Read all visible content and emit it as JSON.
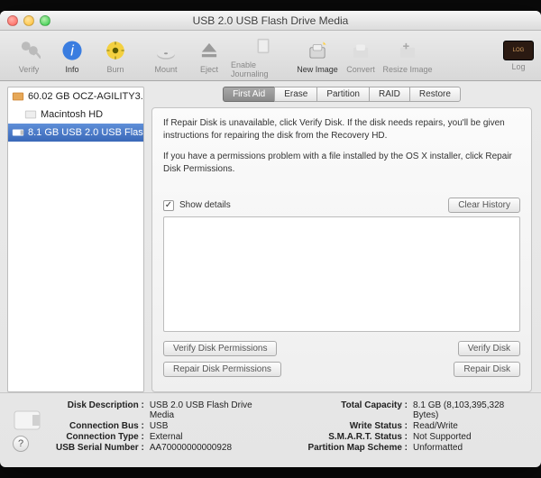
{
  "window": {
    "title": "USB 2.0 USB Flash Drive Media"
  },
  "toolbar": {
    "verify": "Verify",
    "info": "Info",
    "burn": "Burn",
    "mount": "Mount",
    "eject": "Eject",
    "enable_journaling": "Enable Journaling",
    "new_image": "New Image",
    "convert": "Convert",
    "resize_image": "Resize Image",
    "log": "Log"
  },
  "sidebar": {
    "items": [
      {
        "label": "60.02 GB OCZ-AGILITY3..."
      },
      {
        "label": "Macintosh HD"
      },
      {
        "label": "8.1 GB USB 2.0 USB Flas..."
      }
    ]
  },
  "tabs": {
    "first_aid": "First Aid",
    "erase": "Erase",
    "partition": "Partition",
    "raid": "RAID",
    "restore": "Restore"
  },
  "panel": {
    "desc1": "If Repair Disk is unavailable, click Verify Disk. If the disk needs repairs, you'll be given instructions for repairing the disk from the Recovery HD.",
    "desc2": "If you have a permissions problem with a file installed by the OS X installer, click Repair Disk Permissions.",
    "show_details": "Show details",
    "clear_history": "Clear History",
    "verify_disk_permissions": "Verify Disk Permissions",
    "verify_disk": "Verify Disk",
    "repair_disk_permissions": "Repair Disk Permissions",
    "repair_disk": "Repair Disk"
  },
  "footer": {
    "labels": {
      "disk_description": "Disk Description :",
      "connection_bus": "Connection Bus :",
      "connection_type": "Connection Type :",
      "usb_serial": "USB Serial Number :",
      "total_capacity": "Total Capacity :",
      "write_status": "Write Status :",
      "smart_status": "S.M.A.R.T. Status :",
      "partition_map_scheme": "Partition Map Scheme :"
    },
    "values": {
      "disk_description": "USB 2.0 USB Flash Drive Media",
      "connection_bus": "USB",
      "connection_type": "External",
      "usb_serial": "AA70000000000928",
      "total_capacity": "8.1 GB (8,103,395,328 Bytes)",
      "write_status": "Read/Write",
      "smart_status": "Not Supported",
      "partition_map_scheme": "Unformatted"
    }
  }
}
